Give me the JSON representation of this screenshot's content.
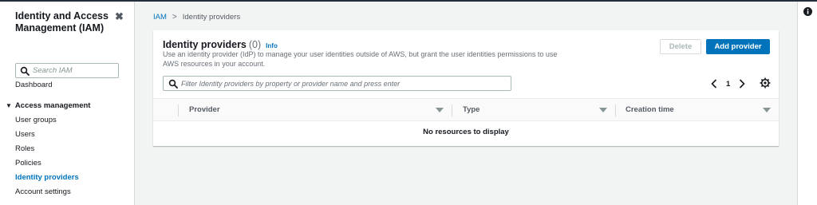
{
  "sidebar": {
    "title": "Identity and Access Management (IAM)",
    "search_placeholder": "Search IAM",
    "dashboard": "Dashboard",
    "section": "Access management",
    "items": [
      {
        "label": "User groups"
      },
      {
        "label": "Users"
      },
      {
        "label": "Roles"
      },
      {
        "label": "Policies"
      },
      {
        "label": "Identity providers"
      },
      {
        "label": "Account settings"
      }
    ],
    "active_item": "Identity providers"
  },
  "breadcrumb": {
    "root": "IAM",
    "current": "Identity providers"
  },
  "panel": {
    "title": "Identity providers",
    "count": "(0)",
    "info": "Info",
    "description": "Use an identity provider (IdP) to manage your user identities outside of AWS, but grant the user identities permissions to use AWS resources in your account.",
    "delete_label": "Delete",
    "add_label": "Add provider",
    "filter_placeholder": "Filter Identity providers by property or provider name and press enter",
    "page": "1",
    "columns": [
      {
        "label": "Provider"
      },
      {
        "label": "Type"
      },
      {
        "label": "Creation time"
      }
    ],
    "empty_text": "No resources to display"
  },
  "icons": {
    "close": "close-icon",
    "search": "search-icon",
    "prev": "chevron-left-icon",
    "next": "chevron-right-icon",
    "settings": "gear-icon",
    "info": "info-icon",
    "sort": "sort-down-icon"
  },
  "colors": {
    "accent": "#0073bb",
    "header": "#232f3e",
    "background": "#f2f3f3",
    "muted_text": "#687078"
  }
}
